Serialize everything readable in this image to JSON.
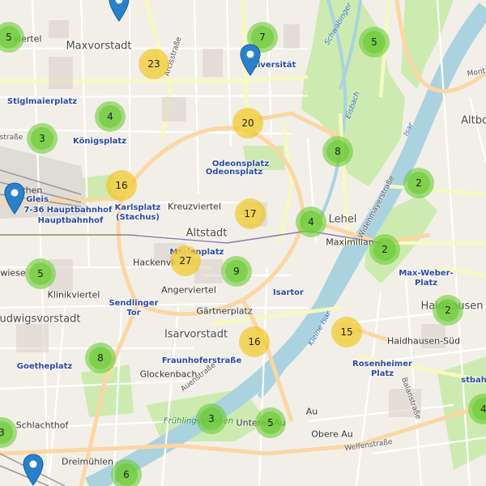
{
  "colors": {
    "background": "#f2efe9",
    "park": "#cdebb0",
    "water": "#aad3df",
    "major_road": "#f7fabf",
    "primary_road": "#fcd6a4",
    "cluster_small": "#6ecc39",
    "cluster_medium": "#f0c20c",
    "marker": "#2a81cb"
  },
  "districts": [
    {
      "label": "Maxvorstadt"
    },
    {
      "label": "Altstadt"
    },
    {
      "label": "Isarvorstadt"
    },
    {
      "label": "Lehel"
    },
    {
      "label": "Haidhausen"
    },
    {
      "label": "Ludwigsvorstadt"
    },
    {
      "label": "Altbo"
    }
  ],
  "areas": [
    {
      "label": "Kreuzviertel"
    },
    {
      "label": "Hackenviertel"
    },
    {
      "label": "Angerviertel"
    },
    {
      "label": "Gärtnerplatz"
    },
    {
      "label": "Glockenbach"
    },
    {
      "label": "Klinikviertel"
    },
    {
      "label": "Schlachthof"
    },
    {
      "label": "Dreimühlen"
    },
    {
      "label": "Haidhausen-Süd"
    },
    {
      "label": "Obere Au"
    },
    {
      "label": "Unteres Au"
    },
    {
      "label": "Au"
    },
    {
      "label": "Maximilian"
    },
    {
      "label": "viertel"
    },
    {
      "label": "wiese"
    },
    {
      "label": "ünchen"
    }
  ],
  "pois": [
    {
      "label": "Stiglmaierplatz"
    },
    {
      "label": "Königsplatz"
    },
    {
      "label": "Universität"
    },
    {
      "label": "Odeonsplatz"
    },
    {
      "label": "Odeonsplatz"
    },
    {
      "label": "Hauptbahnhof"
    },
    {
      "label": "Hauptbahnhof"
    },
    {
      "label": "Karlsplatz\n(Stachus)"
    },
    {
      "label": "Marienplatz"
    },
    {
      "label": "Isartor"
    },
    {
      "label": "Sendlinger\nTor"
    },
    {
      "label": "Goetheplatz"
    },
    {
      "label": "Fraunhoferstraße"
    },
    {
      "label": "Rosenheimer\nPlatz"
    },
    {
      "label": "Max-Weber-\nPlatz"
    },
    {
      "label": "Gleis"
    },
    {
      "label": "7-36"
    },
    {
      "label": "stbah"
    }
  ],
  "streets": [
    {
      "label": "Arcisstraße"
    },
    {
      "label": "Widenmayerstraße"
    },
    {
      "label": "Auenstraße"
    },
    {
      "label": "Balanstraße"
    },
    {
      "label": "Welfenstraße"
    },
    {
      "label": "straße"
    },
    {
      "label": "Mont"
    }
  ],
  "waters": [
    {
      "label": "Schwabinger"
    },
    {
      "label": "Eisbach"
    },
    {
      "label": "Isar"
    },
    {
      "label": "Kleine Isar"
    }
  ],
  "greens": [
    {
      "label": "Frühlingsanlagen"
    }
  ],
  "clusters": [
    {
      "count": "5",
      "level": "small"
    },
    {
      "count": "7",
      "level": "small"
    },
    {
      "count": "5",
      "level": "small"
    },
    {
      "count": "23",
      "level": "medium"
    },
    {
      "count": "4",
      "level": "small"
    },
    {
      "count": "20",
      "level": "medium"
    },
    {
      "count": "3",
      "level": "small"
    },
    {
      "count": "8",
      "level": "small"
    },
    {
      "count": "16",
      "level": "medium"
    },
    {
      "count": "2",
      "level": "small"
    },
    {
      "count": "17",
      "level": "medium"
    },
    {
      "count": "4",
      "level": "small"
    },
    {
      "count": "2",
      "level": "small"
    },
    {
      "count": "5",
      "level": "small"
    },
    {
      "count": "27",
      "level": "medium"
    },
    {
      "count": "9",
      "level": "small"
    },
    {
      "count": "2",
      "level": "small"
    },
    {
      "count": "15",
      "level": "medium"
    },
    {
      "count": "8",
      "level": "small"
    },
    {
      "count": "16",
      "level": "medium"
    },
    {
      "count": "3",
      "level": "small"
    },
    {
      "count": "5",
      "level": "small"
    },
    {
      "count": "4",
      "level": "small"
    },
    {
      "count": "3",
      "level": "small"
    },
    {
      "count": "6",
      "level": "small"
    }
  ],
  "markers": [
    {
      "icon": "map-marker-icon"
    },
    {
      "icon": "map-marker-icon"
    },
    {
      "icon": "map-marker-icon"
    },
    {
      "icon": "map-marker-icon"
    }
  ]
}
